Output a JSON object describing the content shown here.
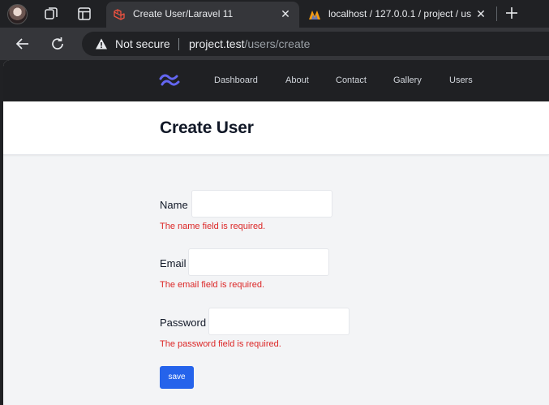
{
  "browser": {
    "tabs": [
      {
        "title": "Create User/Laravel 11",
        "active": true,
        "favicon": "laravel-icon"
      },
      {
        "title": "localhost / 127.0.0.1 / project / us",
        "active": false,
        "favicon": "phpmyadmin-icon"
      }
    ],
    "address": {
      "security_label": "Not secure",
      "host": "project.test",
      "path": "/users/create"
    }
  },
  "nav": {
    "links": [
      "Dashboard",
      "About",
      "Contact",
      "Gallery",
      "Users"
    ]
  },
  "header": {
    "title": "Create User"
  },
  "form": {
    "fields": [
      {
        "label": "Name",
        "value": "",
        "error": "The name field is required."
      },
      {
        "label": "Email",
        "value": "",
        "error": "The email field is required."
      },
      {
        "label": "Password",
        "value": "",
        "error": "The password field is required."
      }
    ],
    "submit_label": "save"
  },
  "colors": {
    "nav_bg": "#1f2023",
    "error": "#dc2626",
    "primary": "#2563eb",
    "logo": "#6366f1"
  }
}
